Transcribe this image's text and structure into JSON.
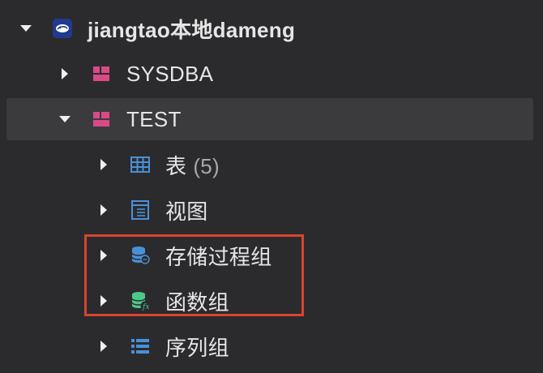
{
  "tree": {
    "connection": {
      "label": "jiangtao本地dameng",
      "icon": "database-connection-icon",
      "expanded": true
    },
    "schemas": [
      {
        "label": "SYSDBA",
        "icon": "schema-icon",
        "expanded": false
      },
      {
        "label": "TEST",
        "icon": "schema-icon",
        "expanded": true,
        "selected": true
      }
    ],
    "children": [
      {
        "label": "表",
        "count": "(5)",
        "icon": "table-icon"
      },
      {
        "label": "视图",
        "icon": "view-icon"
      },
      {
        "label": "存储过程组",
        "icon": "stored-procedure-group-icon"
      },
      {
        "label": "函数组",
        "icon": "function-group-icon"
      },
      {
        "label": "序列组",
        "icon": "sequence-group-icon"
      }
    ]
  },
  "colors": {
    "background": "#2b2b2d",
    "selected_row": "#3b3b3e",
    "schema_icon": "#d94a86",
    "table_icon": "#4a90d9",
    "function_icon": "#4cc98a",
    "highlight_border": "#d9442f"
  }
}
